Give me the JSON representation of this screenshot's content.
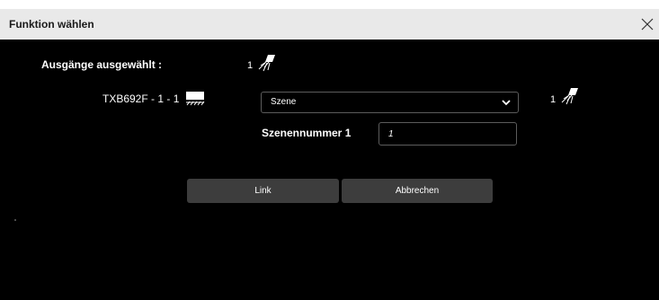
{
  "dialog": {
    "title": "Funktion wählen"
  },
  "outputs": {
    "label": "Ausgänge ausgewählt :",
    "count": "1"
  },
  "device": {
    "name": "TXB692F - 1 - 1",
    "function_select": {
      "selected": "Szene"
    },
    "count": "1"
  },
  "scene": {
    "label": "Szenennummer 1",
    "value": "1"
  },
  "buttons": {
    "link": "Link",
    "cancel": "Abbrechen"
  },
  "icons": {
    "close": "close-icon",
    "multi_output": "light-fixture-icon",
    "device": "blind-shutter-icon",
    "chevron": "chevron-down-icon"
  },
  "colors": {
    "background": "#000000",
    "titlebar": "#e9e9e9",
    "button": "#3d3d3d",
    "border": "#5c5c5c"
  }
}
